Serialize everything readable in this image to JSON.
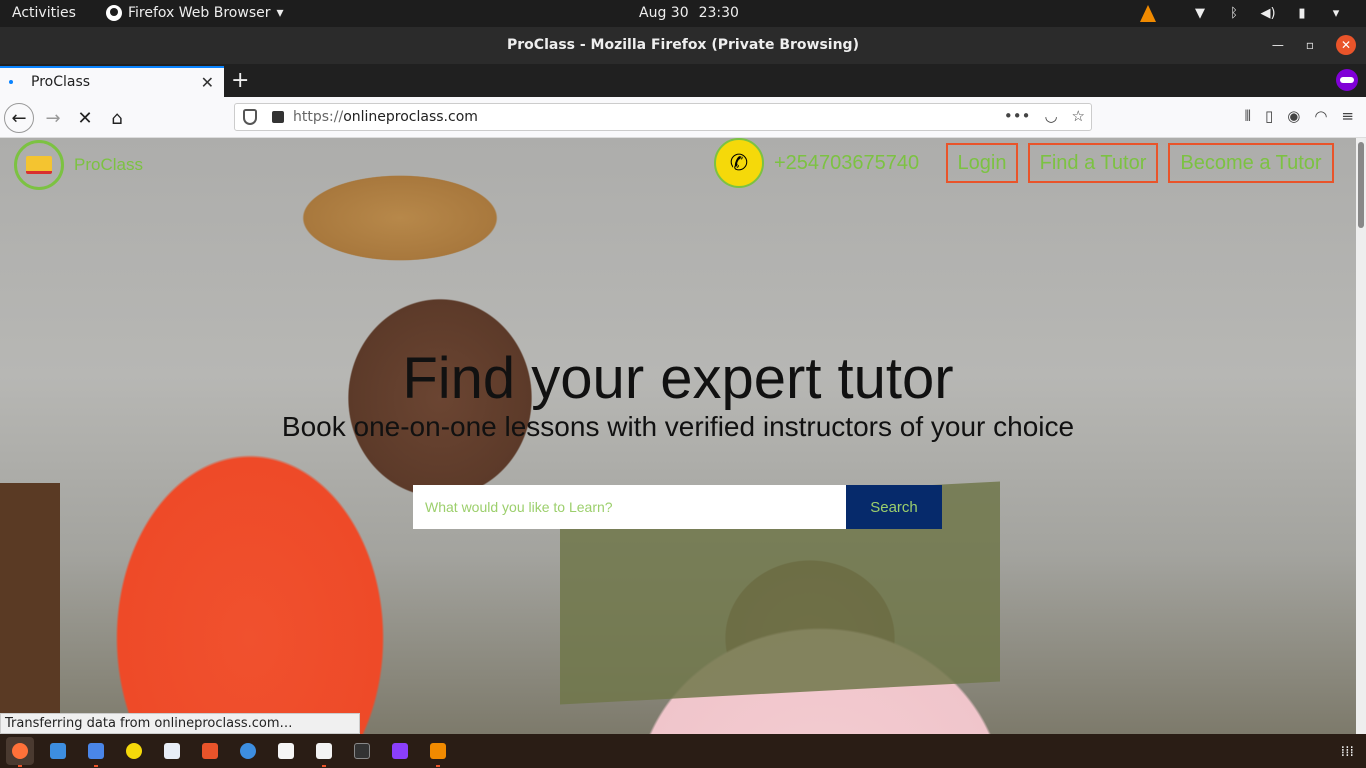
{
  "system": {
    "activities": "Activities",
    "app_menu": "Firefox Web Browser",
    "date": "Aug 30",
    "time": "23:30"
  },
  "window": {
    "title": "ProClass - Mozilla Firefox (Private Browsing)"
  },
  "tab": {
    "label": "ProClass"
  },
  "urlbar": {
    "protocol": "https://",
    "domain": "onlineproclass.com"
  },
  "site": {
    "logo_name": "ProClass",
    "phone": "+254703675740",
    "nav": {
      "login": "Login",
      "find_tutor": "Find a Tutor",
      "become_tutor": "Become a Tutor"
    },
    "hero_title": "Find your expert tutor",
    "hero_subtitle": "Book one-on-one lessons with verified instructors of your choice",
    "search_placeholder": "What would you like to Learn?",
    "search_button": "Search"
  },
  "status_text": "Transferring data from onlineproclass.com…",
  "colors": {
    "brand_green": "#7cc242",
    "accent_orange": "#e9542a",
    "search_blue": "#062a6b",
    "phone_yellow": "#f5d90a"
  },
  "dock": {
    "icons": [
      "firefox-icon",
      "files-icon",
      "document-icon",
      "rhythmbox-icon",
      "text-editor-icon",
      "software-icon",
      "help-icon",
      "amazon-icon",
      "notes-icon",
      "terminal-icon",
      "phpstorm-icon",
      "vlc-icon"
    ]
  }
}
